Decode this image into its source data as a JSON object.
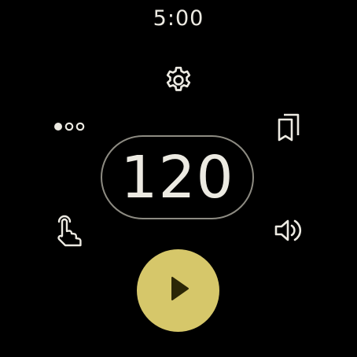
{
  "status_bar": {
    "time": "5:00"
  },
  "controls": {
    "settings_icon": "gear-icon",
    "more_icon": "more-horiz-icon",
    "bookmarks_icon": "bookmarks-icon",
    "tap_tempo_icon": "touch-icon",
    "volume_icon": "volume-icon",
    "play_icon": "play-icon"
  },
  "tempo": {
    "bpm": "120"
  },
  "colors": {
    "background": "#000000",
    "text": "#eceae2",
    "pill_border": "#8d8b82",
    "play_button": "#d6c76a",
    "play_glyph": "#2b2606"
  }
}
